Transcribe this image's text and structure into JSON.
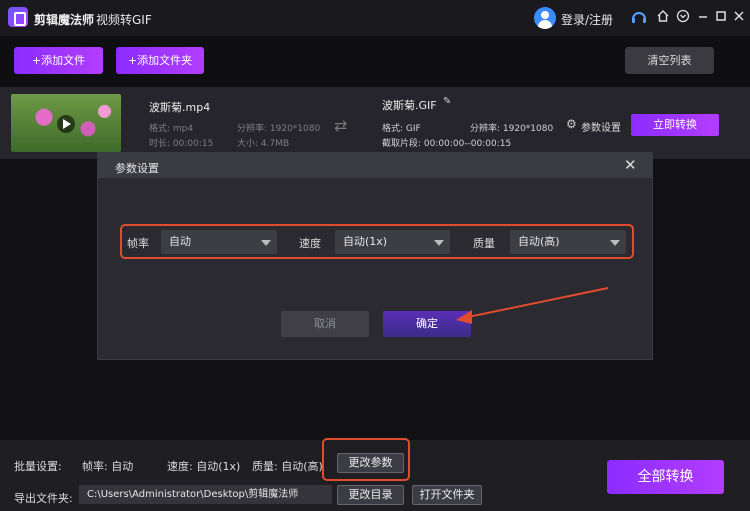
{
  "titlebar": {
    "app_name": "剪辑魔法师",
    "separator": "-",
    "subtitle": "视频转GIF",
    "login": "登录/注册",
    "icons": [
      "headset-icon",
      "home-icon",
      "settings-icon",
      "minimize-icon",
      "maximize-icon",
      "close-icon"
    ]
  },
  "toolbar": {
    "add_file": "+添加文件",
    "add_folder": "+添加文件夹",
    "clear_list": "清空列表"
  },
  "file": {
    "src_name": "波斯菊.mp4",
    "src_format": "格式: mp4",
    "src_resolution": "分辨率: 1920*1080",
    "src_duration": "时长: 00:00:15",
    "src_size": "大小: 4.7MB",
    "out_name": "波斯菊.GIF",
    "out_format": "格式: GIF",
    "out_resolution": "分辨率: 1920*1080",
    "out_clip": "截取片段: 00:00:00--00:00:15",
    "param_settings": "参数设置",
    "convert_now": "立即转换"
  },
  "dialog": {
    "title": "参数设置",
    "framerate_label": "帧率",
    "framerate_value": "自动",
    "speed_label": "速度",
    "speed_value": "自动(1x)",
    "quality_label": "质量",
    "quality_value": "自动(高)",
    "cancel": "取消",
    "confirm": "确定"
  },
  "footer": {
    "batch_label": "批量设置:",
    "framerate": "帧率: 自动",
    "speed": "速度: 自动(1x)",
    "quality": "质量: 自动(高)",
    "change_params": "更改参数",
    "output_label": "导出文件夹:",
    "output_path": "C:\\Users\\Administrator\\Desktop\\剪辑魔法师",
    "change_dir": "更改目录",
    "open_folder": "打开文件夹",
    "convert_all": "全部转换"
  },
  "colors": {
    "accent": "#a033ff",
    "highlight": "#e24c2e",
    "background": "#0f0f12"
  }
}
